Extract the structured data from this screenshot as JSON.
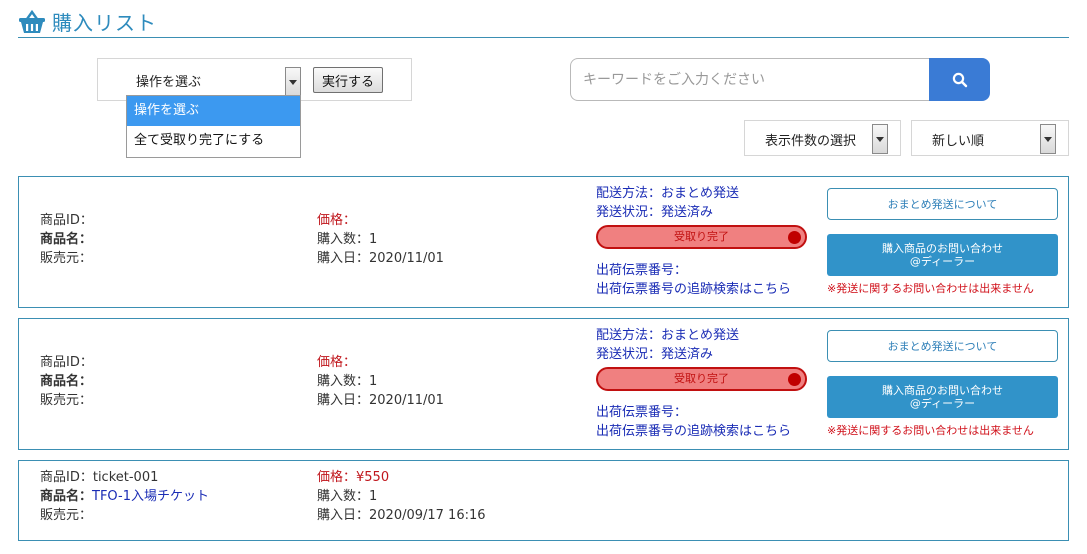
{
  "header": {
    "title": "購入リスト",
    "icon": "basket-icon",
    "accent": "#2e8bbd"
  },
  "bulk_action": {
    "selected": "操作を選ぶ",
    "execute_label": "実行する",
    "options": [
      "操作を選ぶ",
      "全て受取り完了にする"
    ]
  },
  "search": {
    "placeholder": "キーワードをご入力ください",
    "button_color": "#3a7bd5"
  },
  "display_count": {
    "label": "表示件数の選択"
  },
  "sort": {
    "label": "新しい順"
  },
  "orders": [
    {
      "product_id_label": "商品ID：",
      "product_name_label": "商品名：",
      "seller_label": "販売元：",
      "price_label": "価格：",
      "quantity": "購入数：1",
      "purchase_date": "購入日：2020/11/01",
      "delivery_method": "配送方法：おまとめ発送",
      "delivery_status": "発送状況：発送済み",
      "received_badge": "受取り完了",
      "tracking_label": "出荷伝票番号：",
      "tracking_link": "出荷伝票番号の追跡検索はこちら",
      "bulk_shipping_button": "おまとめ発送について",
      "inquiry_button_line1": "購入商品のお問い合わせ",
      "inquiry_button_line2": "@ディーラー",
      "note": "※発送に関するお問い合わせは出来ません"
    },
    {
      "product_id_label": "商品ID：",
      "product_name_label": "商品名：",
      "seller_label": "販売元：",
      "price_label": "価格：",
      "quantity": "購入数：1",
      "purchase_date": "購入日：2020/11/01",
      "delivery_method": "配送方法：おまとめ発送",
      "delivery_status": "発送状況：発送済み",
      "received_badge": "受取り完了",
      "tracking_label": "出荷伝票番号：",
      "tracking_link": "出荷伝票番号の追跡検索はこちら",
      "bulk_shipping_button": "おまとめ発送について",
      "inquiry_button_line1": "購入商品のお問い合わせ",
      "inquiry_button_line2": "@ディーラー",
      "note": "※発送に関するお問い合わせは出来ません"
    },
    {
      "product_id": "商品ID：ticket-001",
      "product_name_label": "商品名：",
      "product_name": "TFO-1入場チケット",
      "seller_label": "販売元：",
      "price": "価格：¥550",
      "quantity": "購入数：1",
      "purchase_date": "購入日：2020/09/17 16:16"
    }
  ],
  "colors": {
    "border": "#3b8fb3",
    "price_red": "#c0161c",
    "link_blue": "#1a2cb5",
    "badge_bg": "#f08080",
    "button_blue": "#3193c9"
  }
}
